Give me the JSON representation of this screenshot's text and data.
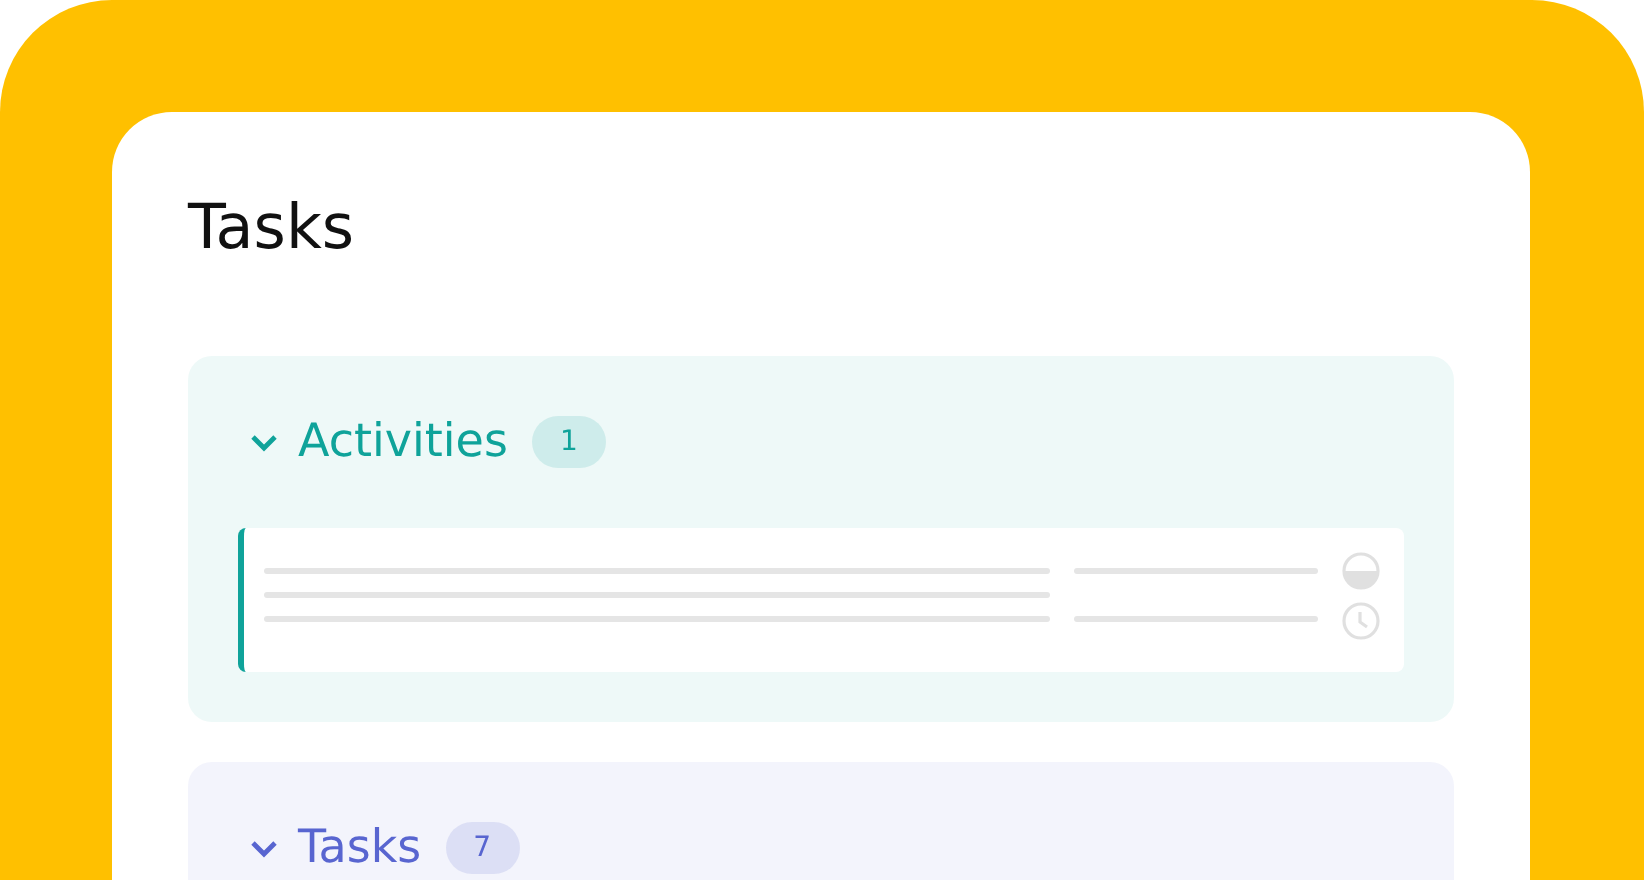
{
  "title": "Tasks",
  "groups": [
    {
      "label": "Activities",
      "count": "1",
      "expanded": true,
      "color": "#0fa39a",
      "cards": [
        {
          "kind": "placeholder"
        }
      ]
    },
    {
      "label": "Tasks",
      "count": "7",
      "expanded": true,
      "color": "#5865d0"
    }
  ]
}
